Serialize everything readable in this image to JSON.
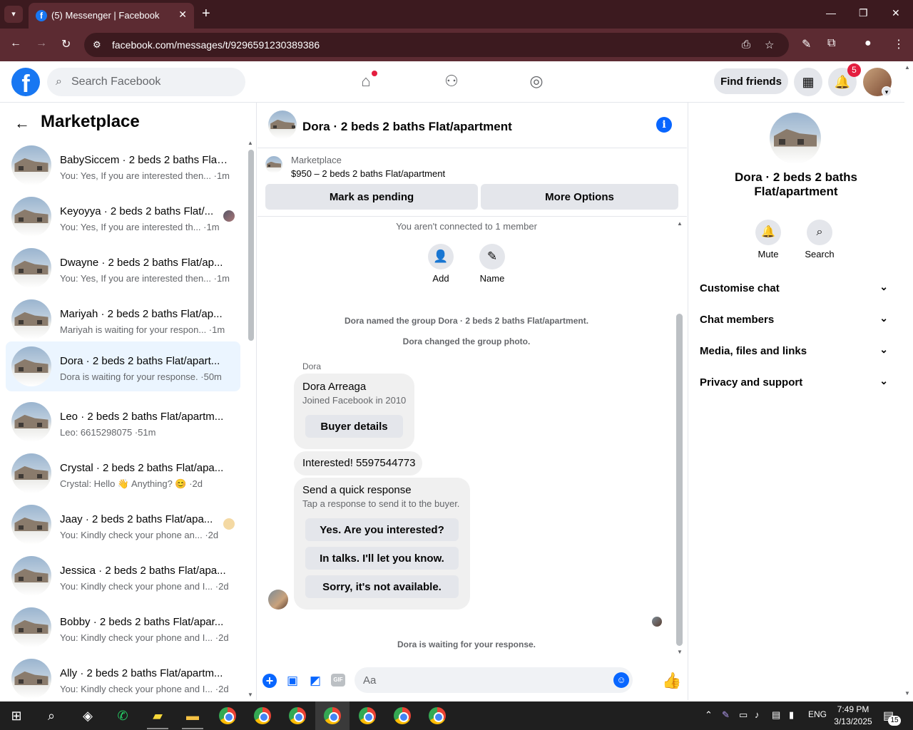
{
  "browser": {
    "tab_title": "(5) Messenger | Facebook",
    "tab_close": "✕",
    "new_tab": "+",
    "url": "facebook.com/messages/t/9296591230389386"
  },
  "fb_header": {
    "logo": "f",
    "search_placeholder": "Search Facebook",
    "find_friends": "Find friends",
    "notifications_count": "5"
  },
  "left_panel": {
    "title": "Marketplace",
    "conversations": [
      {
        "name": "BabySiccem · 2 beds 2 baths Flat...",
        "snippet": "You: Yes, If you are interested then... ·1m"
      },
      {
        "name": "Keyoyya · 2 beds 2 baths Flat/...",
        "snippet": "You: Yes, If you are interested th... ·1m"
      },
      {
        "name": "Dwayne · 2 beds 2 baths Flat/ap...",
        "snippet": "You: Yes, If you are interested then... ·1m"
      },
      {
        "name": "Mariyah · 2 beds 2 baths Flat/ap...",
        "snippet": "Mariyah is waiting for your respon... ·1m"
      },
      {
        "name": "Dora · 2 beds 2 baths Flat/apart...",
        "snippet": "Dora is waiting for your response. ·50m"
      },
      {
        "name": "Leo · 2 beds 2 baths Flat/apartm...",
        "snippet": "Leo: 6615298075 ·51m"
      },
      {
        "name": "Crystal · 2 beds 2 baths Flat/apa...",
        "snippet": "Crystal: Hello 👋 Anything? 😊 ·2d"
      },
      {
        "name": "Jaay · 2 beds 2 baths Flat/apa...",
        "snippet": "You: Kindly check your phone an... ·2d"
      },
      {
        "name": "Jessica · 2 beds 2 baths Flat/apa...",
        "snippet": "You: Kindly check your phone and I... ·2d"
      },
      {
        "name": "Bobby · 2 beds 2 baths Flat/apar...",
        "snippet": "You: Kindly check your phone and I... ·2d"
      },
      {
        "name": "Ally · 2 beds 2 baths Flat/apartm...",
        "snippet": "You: Kindly check your phone and I... ·2d"
      }
    ]
  },
  "chat": {
    "title": "Dora · 2 beds 2 baths Flat/apartment",
    "marketplace_label": "Marketplace",
    "listing": "$950 – 2 beds 2 baths Flat/apartment",
    "mark_pending": "Mark as pending",
    "more_options": "More Options",
    "not_connected": "You aren't connected to 1 member",
    "add_label": "Add",
    "name_label": "Name",
    "sys_named": "Dora named the group Dora · 2 beds 2 baths Flat/apartment.",
    "sys_photo": "Dora changed the group photo.",
    "sender": "Dora",
    "buyer_name": "Dora Arreaga",
    "buyer_joined": "Joined Facebook in 2010",
    "buyer_details": "Buyer details",
    "message": "Interested! 5597544773",
    "quick_title": "Send a quick response",
    "quick_sub": "Tap a response to send it to the buyer.",
    "quick_1": "Yes. Are you interested?",
    "quick_2": "In talks. I'll let you know.",
    "quick_3": "Sorry, it's not available.",
    "waiting": "Dora is waiting for your response.",
    "composer_placeholder": "Aa",
    "gif": "GIF"
  },
  "right_panel": {
    "name": "Dora · 2 beds 2 baths Flat/apartment",
    "mute": "Mute",
    "search": "Search",
    "sections": [
      "Customise chat",
      "Chat members",
      "Media, files and links",
      "Privacy and support"
    ]
  },
  "taskbar": {
    "lang": "ENG",
    "time": "7:49 PM",
    "date": "3/13/2025",
    "notif_count": "15"
  },
  "colors": {
    "fb_blue": "#1877f2",
    "messenger_blue": "#0866ff",
    "badge_red": "#e41e3f",
    "chrome_frame": "#3c1a1f",
    "active_row": "#ebf5ff"
  }
}
